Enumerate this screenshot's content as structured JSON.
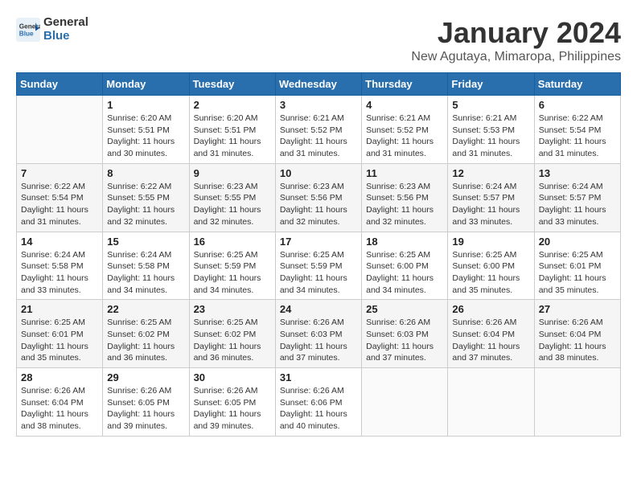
{
  "logo": {
    "line1": "General",
    "line2": "Blue"
  },
  "title": "January 2024",
  "subtitle": "New Agutaya, Mimaropa, Philippines",
  "days_of_week": [
    "Sunday",
    "Monday",
    "Tuesday",
    "Wednesday",
    "Thursday",
    "Friday",
    "Saturday"
  ],
  "weeks": [
    [
      {
        "day": "",
        "info": ""
      },
      {
        "day": "1",
        "info": "Sunrise: 6:20 AM\nSunset: 5:51 PM\nDaylight: 11 hours\nand 30 minutes."
      },
      {
        "day": "2",
        "info": "Sunrise: 6:20 AM\nSunset: 5:51 PM\nDaylight: 11 hours\nand 31 minutes."
      },
      {
        "day": "3",
        "info": "Sunrise: 6:21 AM\nSunset: 5:52 PM\nDaylight: 11 hours\nand 31 minutes."
      },
      {
        "day": "4",
        "info": "Sunrise: 6:21 AM\nSunset: 5:52 PM\nDaylight: 11 hours\nand 31 minutes."
      },
      {
        "day": "5",
        "info": "Sunrise: 6:21 AM\nSunset: 5:53 PM\nDaylight: 11 hours\nand 31 minutes."
      },
      {
        "day": "6",
        "info": "Sunrise: 6:22 AM\nSunset: 5:54 PM\nDaylight: 11 hours\nand 31 minutes."
      }
    ],
    [
      {
        "day": "7",
        "info": "Sunrise: 6:22 AM\nSunset: 5:54 PM\nDaylight: 11 hours\nand 31 minutes."
      },
      {
        "day": "8",
        "info": "Sunrise: 6:22 AM\nSunset: 5:55 PM\nDaylight: 11 hours\nand 32 minutes."
      },
      {
        "day": "9",
        "info": "Sunrise: 6:23 AM\nSunset: 5:55 PM\nDaylight: 11 hours\nand 32 minutes."
      },
      {
        "day": "10",
        "info": "Sunrise: 6:23 AM\nSunset: 5:56 PM\nDaylight: 11 hours\nand 32 minutes."
      },
      {
        "day": "11",
        "info": "Sunrise: 6:23 AM\nSunset: 5:56 PM\nDaylight: 11 hours\nand 32 minutes."
      },
      {
        "day": "12",
        "info": "Sunrise: 6:24 AM\nSunset: 5:57 PM\nDaylight: 11 hours\nand 33 minutes."
      },
      {
        "day": "13",
        "info": "Sunrise: 6:24 AM\nSunset: 5:57 PM\nDaylight: 11 hours\nand 33 minutes."
      }
    ],
    [
      {
        "day": "14",
        "info": "Sunrise: 6:24 AM\nSunset: 5:58 PM\nDaylight: 11 hours\nand 33 minutes."
      },
      {
        "day": "15",
        "info": "Sunrise: 6:24 AM\nSunset: 5:58 PM\nDaylight: 11 hours\nand 34 minutes."
      },
      {
        "day": "16",
        "info": "Sunrise: 6:25 AM\nSunset: 5:59 PM\nDaylight: 11 hours\nand 34 minutes."
      },
      {
        "day": "17",
        "info": "Sunrise: 6:25 AM\nSunset: 5:59 PM\nDaylight: 11 hours\nand 34 minutes."
      },
      {
        "day": "18",
        "info": "Sunrise: 6:25 AM\nSunset: 6:00 PM\nDaylight: 11 hours\nand 34 minutes."
      },
      {
        "day": "19",
        "info": "Sunrise: 6:25 AM\nSunset: 6:00 PM\nDaylight: 11 hours\nand 35 minutes."
      },
      {
        "day": "20",
        "info": "Sunrise: 6:25 AM\nSunset: 6:01 PM\nDaylight: 11 hours\nand 35 minutes."
      }
    ],
    [
      {
        "day": "21",
        "info": "Sunrise: 6:25 AM\nSunset: 6:01 PM\nDaylight: 11 hours\nand 35 minutes."
      },
      {
        "day": "22",
        "info": "Sunrise: 6:25 AM\nSunset: 6:02 PM\nDaylight: 11 hours\nand 36 minutes."
      },
      {
        "day": "23",
        "info": "Sunrise: 6:25 AM\nSunset: 6:02 PM\nDaylight: 11 hours\nand 36 minutes."
      },
      {
        "day": "24",
        "info": "Sunrise: 6:26 AM\nSunset: 6:03 PM\nDaylight: 11 hours\nand 37 minutes."
      },
      {
        "day": "25",
        "info": "Sunrise: 6:26 AM\nSunset: 6:03 PM\nDaylight: 11 hours\nand 37 minutes."
      },
      {
        "day": "26",
        "info": "Sunrise: 6:26 AM\nSunset: 6:04 PM\nDaylight: 11 hours\nand 37 minutes."
      },
      {
        "day": "27",
        "info": "Sunrise: 6:26 AM\nSunset: 6:04 PM\nDaylight: 11 hours\nand 38 minutes."
      }
    ],
    [
      {
        "day": "28",
        "info": "Sunrise: 6:26 AM\nSunset: 6:04 PM\nDaylight: 11 hours\nand 38 minutes."
      },
      {
        "day": "29",
        "info": "Sunrise: 6:26 AM\nSunset: 6:05 PM\nDaylight: 11 hours\nand 39 minutes."
      },
      {
        "day": "30",
        "info": "Sunrise: 6:26 AM\nSunset: 6:05 PM\nDaylight: 11 hours\nand 39 minutes."
      },
      {
        "day": "31",
        "info": "Sunrise: 6:26 AM\nSunset: 6:06 PM\nDaylight: 11 hours\nand 40 minutes."
      },
      {
        "day": "",
        "info": ""
      },
      {
        "day": "",
        "info": ""
      },
      {
        "day": "",
        "info": ""
      }
    ]
  ]
}
